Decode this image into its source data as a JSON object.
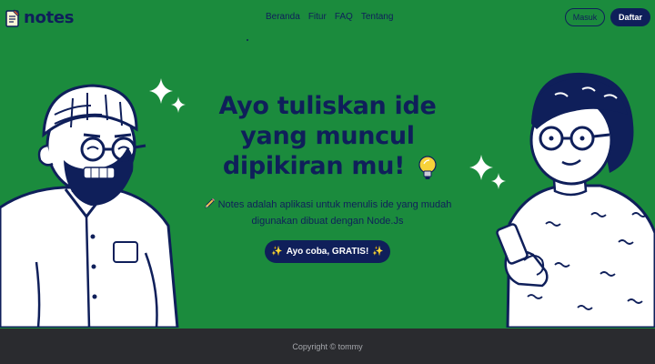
{
  "brand": {
    "name": "notes"
  },
  "nav": {
    "links": [
      "Beranda",
      "Fitur",
      "FAQ",
      "Tentang"
    ],
    "login_label": "Masuk",
    "register_label": "Daftar"
  },
  "hero": {
    "headline_lines": [
      "Ayo tuliskan ide",
      "yang muncul",
      "dipikiran mu!"
    ],
    "description_line1": "Notes adalah aplikasi untuk menulis ide yang mudah",
    "description_line2": "digunakan dibuat dengan Node.Js",
    "cta_label": "Ayo coba, GRATIS!",
    "cta_sparkle": "✨"
  },
  "footer": {
    "text": "Copyright © tommy"
  },
  "colors": {
    "background": "#1b8b3d",
    "navy": "#0f1f5a",
    "footer": "#2a2b2f",
    "accent": "#f7d23a"
  },
  "icons": [
    "notepad-icon",
    "lightbulb-icon",
    "pencil-icon",
    "sparkle-icon"
  ]
}
